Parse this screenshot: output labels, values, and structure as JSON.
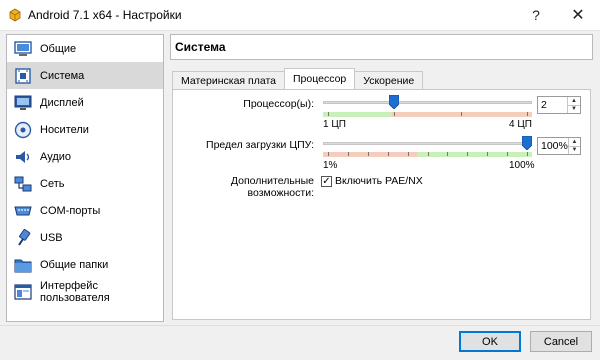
{
  "window": {
    "title": "Android 7.1 x64 - Настройки",
    "help_label": "?",
    "close_label": "✕"
  },
  "sidebar": {
    "items": [
      {
        "label": "Общие",
        "icon": "general-icon"
      },
      {
        "label": "Система",
        "icon": "motherboard-icon",
        "active": true
      },
      {
        "label": "Дисплей",
        "icon": "display-icon"
      },
      {
        "label": "Носители",
        "icon": "storage-icon"
      },
      {
        "label": "Аудио",
        "icon": "audio-icon"
      },
      {
        "label": "Сеть",
        "icon": "network-icon"
      },
      {
        "label": "COM-порты",
        "icon": "serial-port-icon"
      },
      {
        "label": "USB",
        "icon": "usb-icon"
      },
      {
        "label": "Общие папки",
        "icon": "shared-folder-icon"
      },
      {
        "label": "Интерфейс пользователя",
        "icon": "user-interface-icon"
      }
    ]
  },
  "page": {
    "title": "Система",
    "tabs": [
      "Материнская плата",
      "Процессор",
      "Ускорение"
    ],
    "active_tab": 1
  },
  "processor": {
    "cpu_label": "Процессор(ы):",
    "cpu_min_label": "1 ЦП",
    "cpu_max_label": "4 ЦП",
    "cpu_value": "2",
    "cpu_slider_fraction": 0.33,
    "exec_cap_label": "Предел загрузки ЦПУ:",
    "exec_min_label": "1%",
    "exec_max_label": "100%",
    "exec_value": "100%",
    "exec_slider_fraction": 1.0,
    "ext_features_label": "Дополнительные возможности:",
    "pae_label": "Включить PAE/NX",
    "pae_checked": true
  },
  "footer": {
    "ok_label": "OK",
    "cancel_label": "Cancel"
  },
  "colors": {
    "zone_green": "#c9f0b8",
    "zone_red": "#f6ccbc",
    "thumb_blue": "#1c6fd1",
    "accent": "#0078d7"
  }
}
